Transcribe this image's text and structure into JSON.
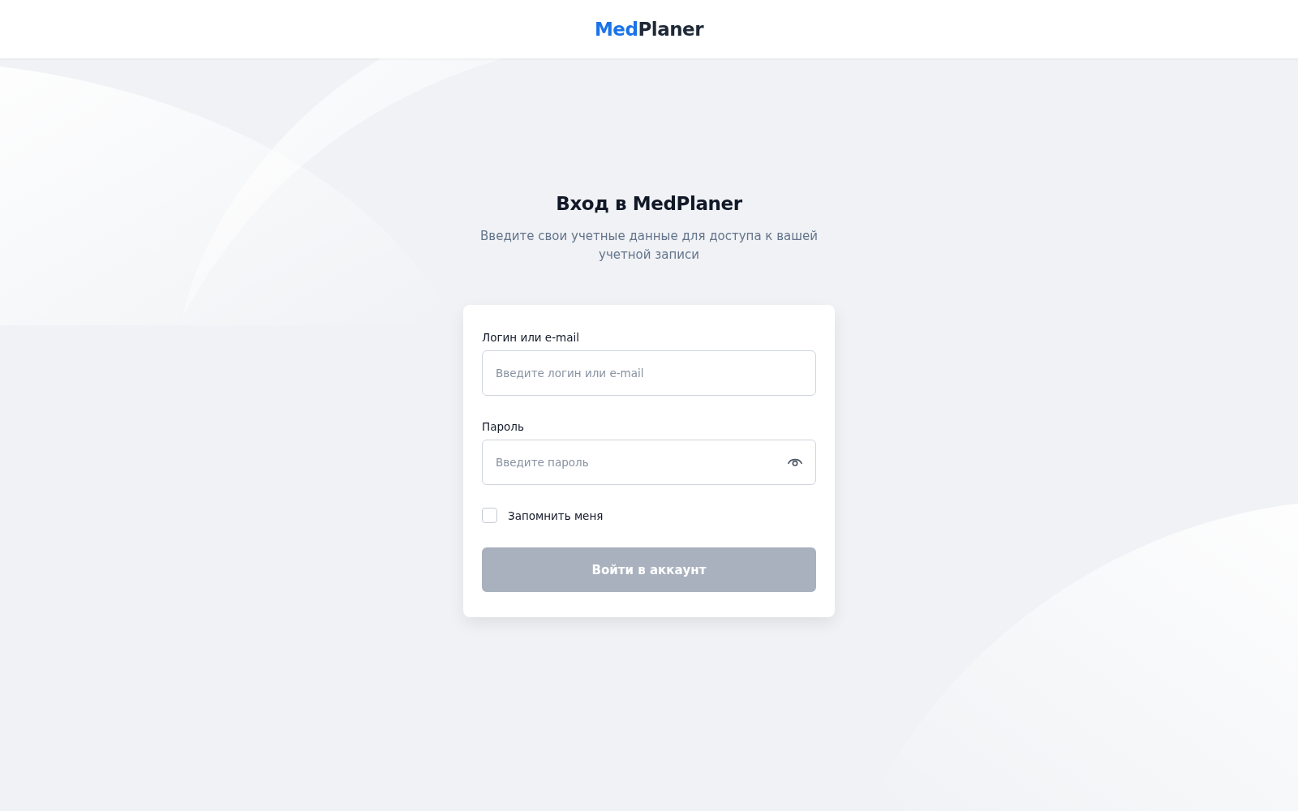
{
  "header": {
    "logo": {
      "accent": "Med",
      "text": "Planer"
    }
  },
  "login": {
    "title": "Вход в MedPlaner",
    "subtitle": "Введите свои учетные данные для доступа к вашей учетной записи",
    "fields": [
      {
        "kind": "text",
        "label": "Логин или e-mail",
        "placeholder": "Введите логин или e-mail"
      },
      {
        "kind": "password",
        "label": "Пароль",
        "placeholder": "Введите пароль"
      }
    ],
    "remember": {
      "label": "Запомнить меня",
      "checked": false
    },
    "submit": {
      "label": "Войти в аккаунт",
      "disabled": true
    }
  }
}
